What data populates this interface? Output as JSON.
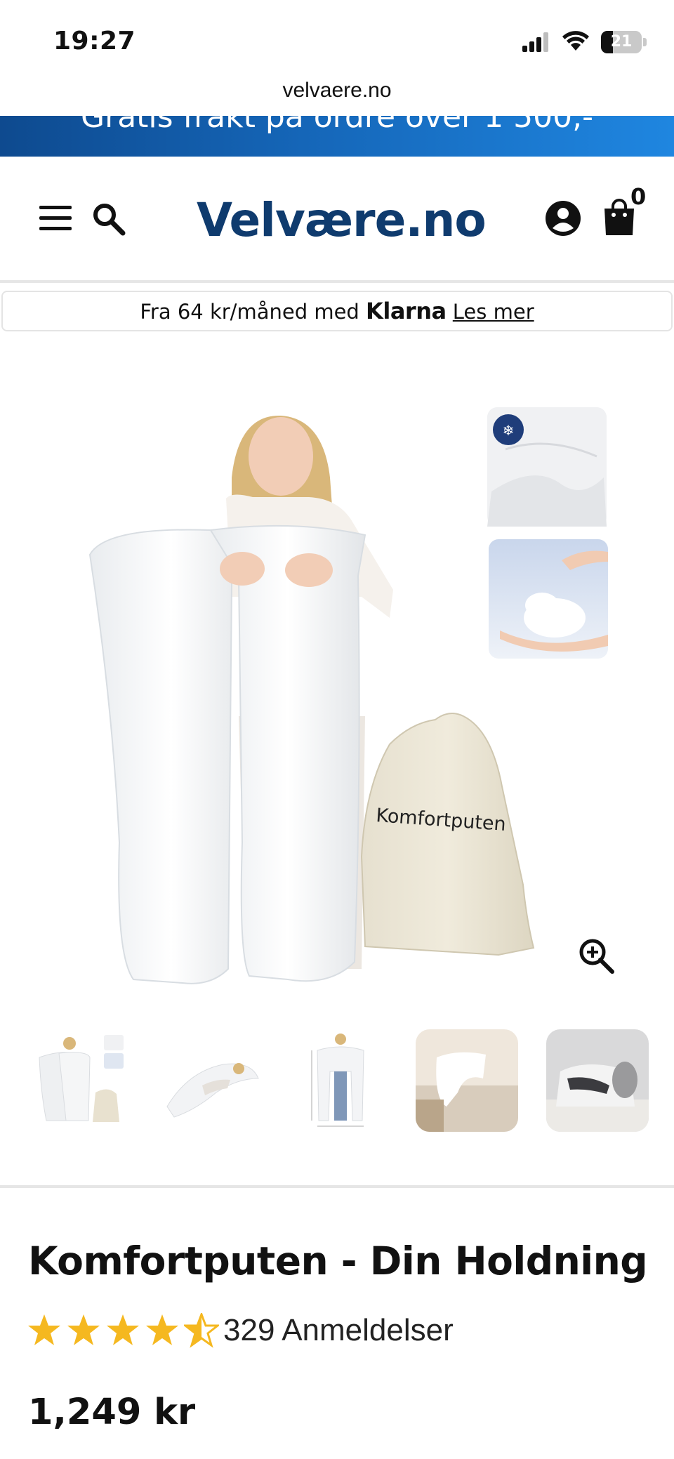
{
  "status_bar": {
    "time": "19:27",
    "battery": "21"
  },
  "browser": {
    "url": "velvaere.no"
  },
  "promo": {
    "text": "Gratis frakt på ordre over 1 500,-"
  },
  "header": {
    "logo": "Velvære.no",
    "cart_count": "0"
  },
  "klarna": {
    "prefix": "Fra 64 kr/måned med ",
    "brand": "Klarna",
    "link": "Les mer"
  },
  "gallery": {
    "bag_label": "Komfortputen",
    "thumb_count": 5
  },
  "product": {
    "title": "Komfortputen - Din Holdning",
    "rating": 4.5,
    "rating_max": 5,
    "reviews": "329 Anmeldelser",
    "price": "1,249 kr"
  },
  "colors": {
    "brand": "#0f3b6e",
    "promo_start": "#0e4a8f",
    "promo_end": "#1f86e0",
    "star": "#f5b820"
  }
}
